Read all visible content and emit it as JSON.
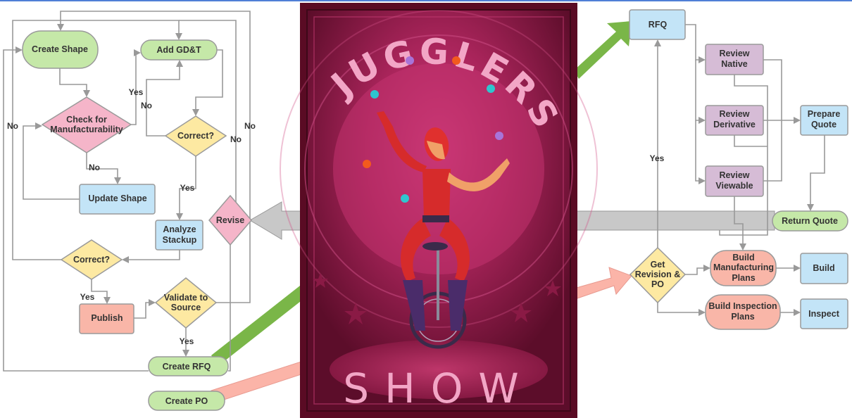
{
  "colors": {
    "green_node": "#c5e8a8",
    "blue_node": "#c3e4f7",
    "pink_node": "#f5b5c9",
    "yellow_node": "#fde9a2",
    "salmon_node": "#f9b6a8",
    "purple_node": "#d6bcd6",
    "connector": "#999999",
    "green_arrow": "#7ab648",
    "pink_arrow": "#fbb4a8",
    "gray_arrow": "#c8c8c8",
    "poster_bg": "#7a1532",
    "poster_text": "#f2a6c6"
  },
  "left_flow": {
    "create_shape": [
      "Create Shape"
    ],
    "add_gdt": [
      "Add GD&T"
    ],
    "check_manufacturability": [
      "Check for",
      "Manufacturability"
    ],
    "correct_1": [
      "Correct?"
    ],
    "update_shape": [
      "Update Shape"
    ],
    "revise": [
      "Revise"
    ],
    "analyze_stackup": [
      "Analyze",
      "Stackup"
    ],
    "correct_2": [
      "Correct?"
    ],
    "publish": [
      "Publish"
    ],
    "validate_source": [
      "Validate to",
      "Source"
    ],
    "create_rfq": [
      "Create RFQ"
    ],
    "create_po": [
      "Create PO"
    ]
  },
  "right_flow": {
    "rfq": [
      "RFQ"
    ],
    "review_native": [
      "Review",
      "Native"
    ],
    "review_derivative": [
      "Review",
      "Derivative"
    ],
    "review_viewable": [
      "Review",
      "Viewable"
    ],
    "prepare_quote": [
      "Prepare",
      "Quote"
    ],
    "return_quote": [
      "Return Quote"
    ],
    "get_revision_po": [
      "Get",
      "Revision &",
      "PO"
    ],
    "build_mfg_plans": [
      "Build",
      "Manufacturing",
      "Plans"
    ],
    "build": [
      "Build"
    ],
    "build_inspection_plans": [
      "Build Inspection",
      "Plans"
    ],
    "inspect": [
      "Inspect"
    ]
  },
  "edge_labels": {
    "yes": "Yes",
    "no": "No"
  },
  "poster": {
    "title": "JUGGLERS",
    "subtitle": "SHOW"
  }
}
